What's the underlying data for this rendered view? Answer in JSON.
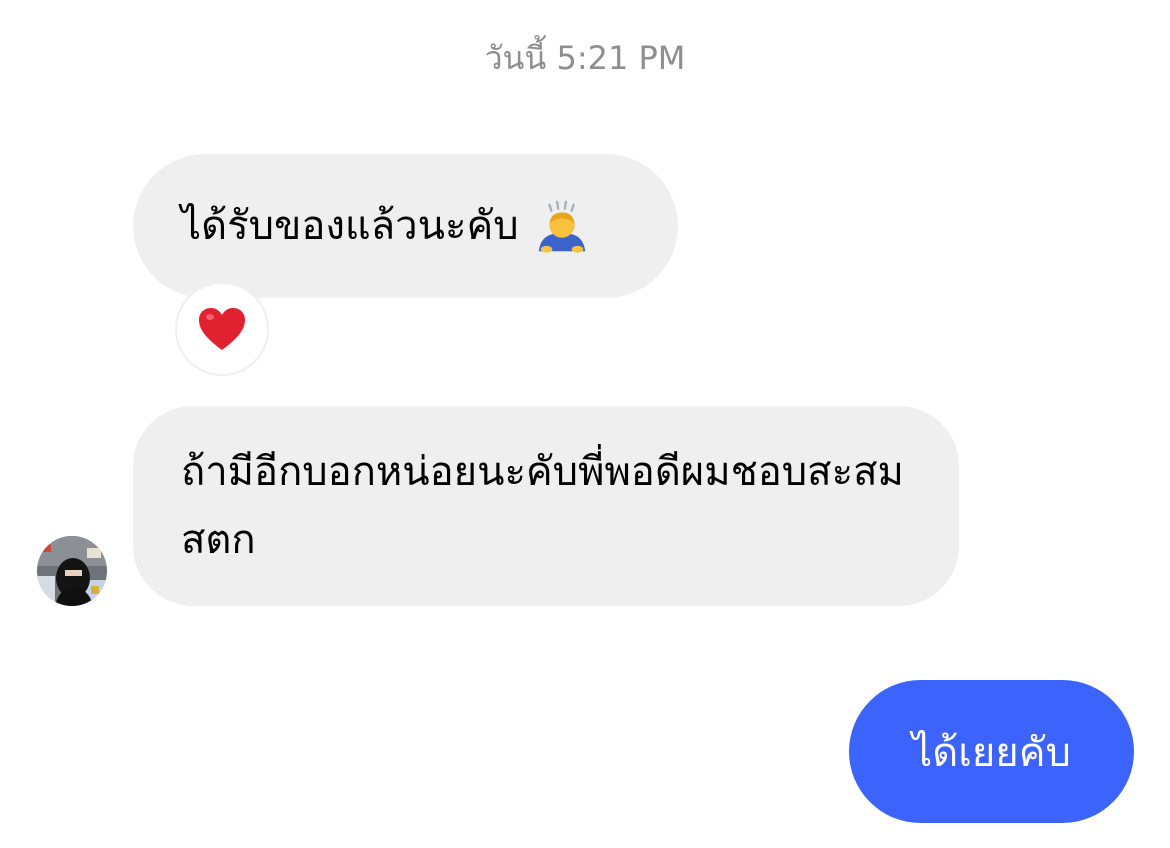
{
  "conversation": {
    "timestamp": "วันนี้ 5:21 PM",
    "messages": [
      {
        "direction": "incoming",
        "text": "ได้รับของแล้วนะคับ",
        "emoji": "person-bowing",
        "reaction": "heart"
      },
      {
        "direction": "incoming",
        "text": "ถ้ามีอีกบอกหน่อยนะคับพี่พอดีผมชอบสะสมสตก"
      },
      {
        "direction": "outgoing",
        "text": "ได้เยยคับ"
      }
    ]
  },
  "colors": {
    "incoming_bubble": "#efefef",
    "outgoing_bubble": "#3c63fb",
    "timestamp_text": "#8e8e8e",
    "reaction_heart": "#e0212f"
  }
}
